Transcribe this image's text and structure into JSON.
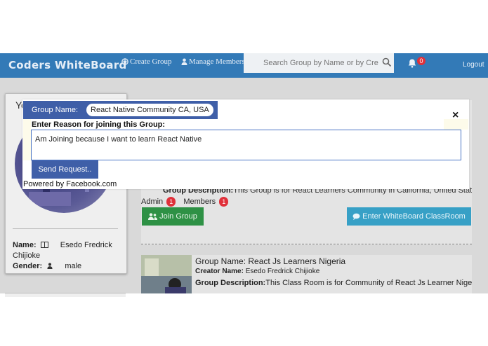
{
  "navbar": {
    "brand": "Coders WhiteBoard",
    "create_group": "Create Group",
    "manage_members": "Manage Members",
    "search_placeholder": "Search Group by Name or by Creator",
    "notification_count": "0",
    "logout": "Logout",
    "icons": [
      "globe-icon",
      "user-icon",
      "search-icon",
      "bell-icon"
    ]
  },
  "profile": {
    "heading_partial": "Yo",
    "name_label": "Name:",
    "name_value": "Esedo Fredrick",
    "name_value_2": "Chijioke",
    "gender_label": "Gender:",
    "gender_value": "male"
  },
  "group1": {
    "desc_label": "Group Description:",
    "desc_value": "This Group is for React Learners Community in California, United States",
    "admin_label": "Admin",
    "admin_count": "1",
    "members_label": "Members",
    "members_count": "1",
    "join_label": "Join Group",
    "enter_label": "Enter WhiteBoard ClassRoom"
  },
  "group2": {
    "name_label": "Group Name:",
    "name_value": "React Js Learners Nigeria",
    "creator_label": "Creator Name:",
    "creator_value": "Esedo Fredrick Chijioke",
    "desc_label": "Group Description:",
    "desc_value": "This Class Room is for Community of React Js Learner Nigeria"
  },
  "modal": {
    "group_name_label": "Group Name:",
    "group_name_value": "React Native Community CA, USA",
    "close": "×",
    "reason_label": "Enter Reason for joining this Group:",
    "reason_value": "Am Joining because I want to learn React Native",
    "send_label": "Send Request..",
    "powered_by": "Powered by Facebook.com"
  },
  "colors": {
    "navbar": "#337ab7",
    "modal_header": "#3f5fa8",
    "join_button": "#2e9145",
    "enter_button": "#37a0c6",
    "badge": "#e0303a"
  }
}
